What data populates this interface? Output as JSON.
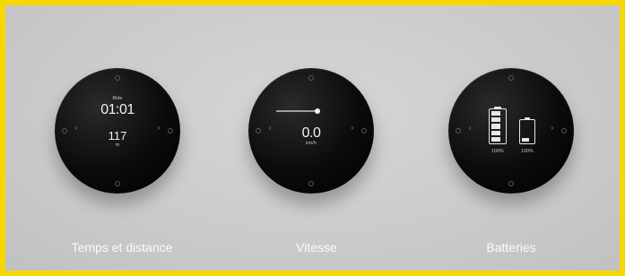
{
  "devices": [
    {
      "label": "Temps et distance",
      "screen": {
        "time_caption": "Ride",
        "time_value": "01:01",
        "distance_value": "117",
        "distance_unit": "m"
      },
      "icons": [
        "chevron-left-icon",
        "chevron-right-icon"
      ]
    },
    {
      "label": "Vitesse",
      "screen": {
        "speed_value": "0.0",
        "speed_unit": "km/h",
        "speed_level": 0.0
      },
      "icons": [
        "chevron-left-icon",
        "chevron-right-icon"
      ]
    },
    {
      "label": "Batteries",
      "screen": {
        "battery_1_percent": "100%",
        "battery_2_percent": "100%",
        "battery_1_level": 1.0,
        "battery_2_level": 0.25
      },
      "icons": [
        "battery-full-icon",
        "battery-low-icon",
        "chevron-left-icon",
        "chevron-right-icon"
      ]
    }
  ],
  "colors": {
    "border": "#f6d800",
    "background": "#c9c9c9",
    "device": "#0b0b0b",
    "screen_text": "#f2f2f2",
    "label_text": "#fafafa"
  }
}
